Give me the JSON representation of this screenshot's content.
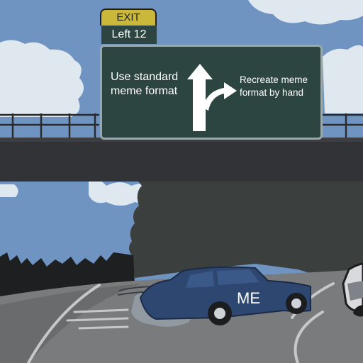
{
  "exit_sign": {
    "tab_label": "EXIT",
    "exit_text": "Left 12",
    "left_option": "Use standard meme format",
    "right_option": "Recreate meme format by hand",
    "icon": "fork-arrow-icon"
  },
  "car": {
    "label": "ME"
  },
  "colors": {
    "sky": "#6f94c2",
    "sign_green": "#2d4540",
    "exit_yellow": "#c9b83a",
    "car_blue": "#2e4770"
  }
}
